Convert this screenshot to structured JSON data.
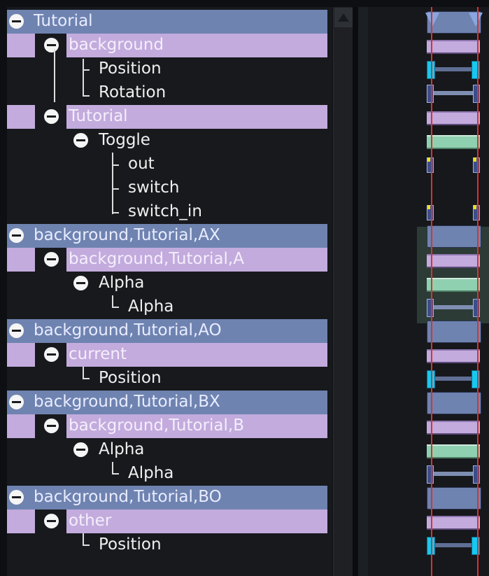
{
  "tree": {
    "rows": [
      {
        "label": "Tutorial",
        "type": "group",
        "level": 0,
        "expanded": true
      },
      {
        "label": "background",
        "type": "group",
        "level": 1,
        "expanded": true
      },
      {
        "label": "Position",
        "type": "param",
        "level": 2
      },
      {
        "label": "Rotation",
        "type": "param",
        "level": 2
      },
      {
        "label": "Tutorial",
        "type": "group",
        "level": 1,
        "expanded": true
      },
      {
        "label": "Toggle",
        "type": "param-group",
        "level": 2,
        "expanded": true
      },
      {
        "label": "out",
        "type": "param",
        "level": 3
      },
      {
        "label": "switch",
        "type": "param",
        "level": 3
      },
      {
        "label": "switch_in",
        "type": "param",
        "level": 3
      },
      {
        "label": "background,Tutorial,AX",
        "type": "group",
        "level": 0,
        "expanded": true
      },
      {
        "label": "background,Tutorial,A",
        "type": "group",
        "level": 1,
        "expanded": true
      },
      {
        "label": "Alpha",
        "type": "param-group",
        "level": 2,
        "expanded": true
      },
      {
        "label": "Alpha",
        "type": "param",
        "level": 3
      },
      {
        "label": "background,Tutorial,AO",
        "type": "group",
        "level": 0,
        "expanded": true
      },
      {
        "label": "current",
        "type": "group",
        "level": 1,
        "expanded": true
      },
      {
        "label": "Position",
        "type": "param",
        "level": 2
      },
      {
        "label": "background,Tutorial,BX",
        "type": "group",
        "level": 0,
        "expanded": true
      },
      {
        "label": "background,Tutorial,B",
        "type": "group",
        "level": 1,
        "expanded": true
      },
      {
        "label": "Alpha",
        "type": "param-group",
        "level": 2,
        "expanded": true
      },
      {
        "label": "Alpha",
        "type": "param",
        "level": 3
      },
      {
        "label": "background,Tutorial,BO",
        "type": "group",
        "level": 0,
        "expanded": true
      },
      {
        "label": "other",
        "type": "group",
        "level": 1,
        "expanded": true
      },
      {
        "label": "Position",
        "type": "param",
        "level": 2
      }
    ]
  },
  "timeline": {
    "row_kinds": [
      "group",
      "layer",
      "vector",
      "angle",
      "layer",
      "toggle",
      "toggle-marker",
      "toggle-marker",
      "toggle-marker",
      "group",
      "layer",
      "alpha",
      "alpha-value",
      "group",
      "layer",
      "vector",
      "group",
      "layer",
      "alpha",
      "alpha-value",
      "group",
      "layer",
      "vector"
    ]
  },
  "colors": {
    "group_band": "#6f83b0",
    "layer_band": "#c3abdd",
    "tree_background": "#17191d",
    "timeline_background": "#16181c",
    "time_cursor": "#e0302a",
    "keyframe_cyan": "#19c8f0",
    "keyframe_yellow": "#f0e020",
    "alpha_bar": "#8fd0b0",
    "keyframe_marker": "#8aa6e0"
  },
  "icons": {
    "collapse": "minus-circle-icon",
    "scroll_up": "triangle-up-icon",
    "keyframe_top": "triangle-down-icon"
  }
}
